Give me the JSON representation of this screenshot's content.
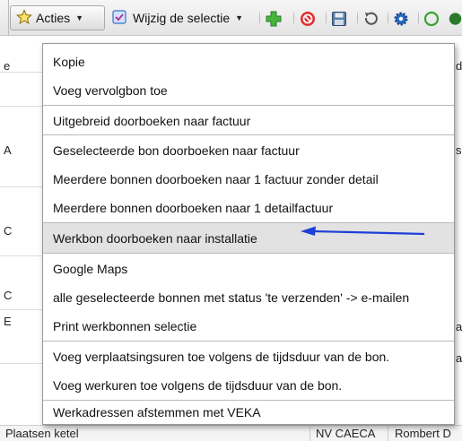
{
  "toolbar": {
    "acties_label": "Acties",
    "wijzig_label": "Wijzig de selectie",
    "icons": [
      "star-icon",
      "plus-icon",
      "stop-icon",
      "save-icon",
      "undo-icon",
      "gear-icon",
      "info-icon"
    ]
  },
  "menu": {
    "items": [
      "Kopie",
      "Voeg vervolgbon toe",
      "Uitgebreid doorboeken naar factuur",
      "Geselecteerde bon doorboeken naar factuur",
      "Meerdere bonnen doorboeken naar 1 factuur zonder detail",
      "Meerdere bonnen doorboeken naar 1 detailfactuur",
      "Werkbon doorboeken naar installatie",
      "Google Maps",
      "alle geselecteerde bonnen met status 'te verzenden' -> e-mailen",
      "Print werkbonnen selectie",
      "Voeg verplaatsingsuren toe volgens de tijdsduur van de bon.",
      "Voeg werkuren toe volgens de tijdsduur van de bon.",
      "Werkadressen afstemmen met VEKA"
    ],
    "highlighted": "Werkbon doorboeken naar installatie"
  },
  "background": {
    "bottom_cells": [
      "Plaatsen ketel",
      "NV CAECA",
      "Rombert D"
    ],
    "left_edge_letters": [
      "e",
      "A",
      "C",
      "C",
      "E"
    ],
    "right_edge_letters": [
      "d",
      "s",
      "a",
      "a"
    ]
  },
  "colors": {
    "arrow": "#1f3fd8",
    "highlight": "#e2e2e2",
    "plus_green": "#3aa335",
    "stop_red": "#d9252b"
  }
}
